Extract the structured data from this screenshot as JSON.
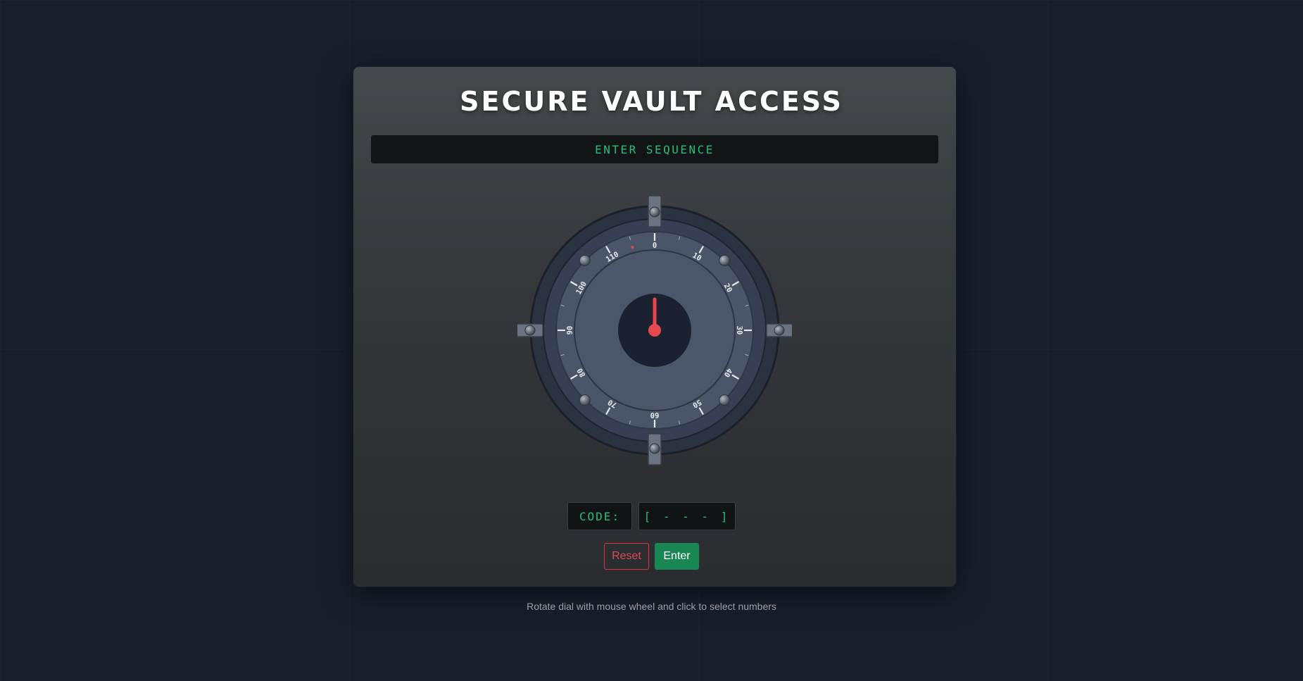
{
  "page": {
    "title": "SECURE VAULT ACCESS",
    "status": "ENTER SEQUENCE"
  },
  "dial": {
    "numbers": [
      "0",
      "10",
      "20",
      "30",
      "40",
      "50",
      "60",
      "70",
      "80",
      "90",
      "100",
      "110"
    ],
    "max_value": 120,
    "current_value": 0,
    "marker_value": 115,
    "pointer_color": "#e5484d"
  },
  "code": {
    "label": "CODE:",
    "value": "[ - - - ]"
  },
  "buttons": {
    "reset": "Reset",
    "enter": "Enter"
  },
  "hint": "Rotate dial with mouse wheel and click to select numbers",
  "colors": {
    "accent_green": "#22c07a",
    "danger": "#dc3545",
    "success": "#198754"
  }
}
